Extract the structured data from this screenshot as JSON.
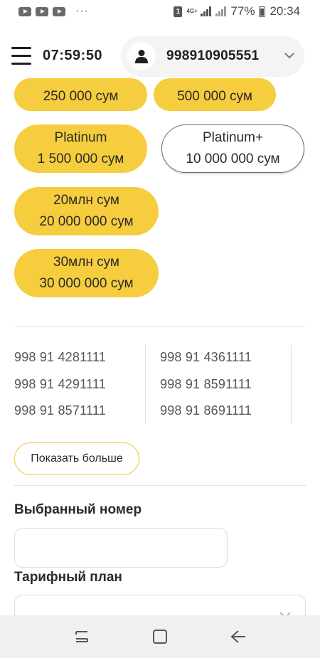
{
  "status_bar": {
    "dots": "···",
    "sim_label": "1",
    "network": "4G+",
    "battery": "77%",
    "time": "20:34"
  },
  "header": {
    "timer": "07:59:50",
    "account_number": "998910905551"
  },
  "tariffs": [
    {
      "name": "",
      "price": "250 000 сум",
      "selected": false
    },
    {
      "name": "",
      "price": "500 000 сум",
      "selected": false
    },
    {
      "name": "Platinum",
      "price": "1 500 000 сум",
      "selected": false
    },
    {
      "name": "Platinum+",
      "price": "10 000 000 сум",
      "selected": true
    },
    {
      "name": "20млн сум",
      "price": "20 000 000 сум",
      "selected": false
    },
    {
      "name": "30млн сум",
      "price": "30 000 000 сум",
      "selected": false
    }
  ],
  "numbers": {
    "col1": [
      "998 91 4281111",
      "998 91 4291111",
      "998 91 8571111"
    ],
    "col2": [
      "998 91 4361111",
      "998 91 8591111",
      "998 91 8691111"
    ]
  },
  "show_more_label": "Показать больше",
  "form": {
    "selected_number_label": "Выбранный номер",
    "selected_number_value": "",
    "tariff_plan_label": "Тарифный план"
  },
  "colors": {
    "accent": "#f6cd3e",
    "text": "#1f1f1f"
  }
}
